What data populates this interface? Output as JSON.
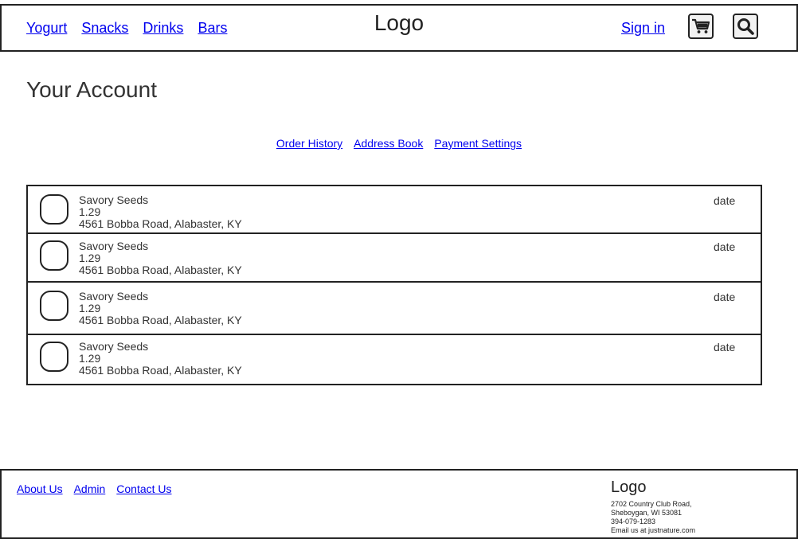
{
  "header": {
    "nav": [
      "Yogurt",
      "Snacks",
      "Drinks",
      "Bars"
    ],
    "logo": "Logo",
    "sign_in": "Sign in",
    "cart_icon": "cart-icon",
    "search_icon": "search-icon"
  },
  "page": {
    "title": "Your Account"
  },
  "subnav": [
    "Order History",
    "Address Book",
    "Payment Settings"
  ],
  "orders": [
    {
      "name": "Savory Seeds",
      "price": "1.29",
      "address": "4561 Bobba Road, Alabaster, KY",
      "date": "date"
    },
    {
      "name": "Savory Seeds",
      "price": "1.29",
      "address": "4561 Bobba Road, Alabaster, KY",
      "date": "date"
    },
    {
      "name": "Savory Seeds",
      "price": "1.29",
      "address": "4561 Bobba Road, Alabaster, KY",
      "date": "date"
    },
    {
      "name": "Savory Seeds",
      "price": "1.29",
      "address": "4561 Bobba Road, Alabaster, KY",
      "date": "date"
    }
  ],
  "footer": {
    "links": [
      "About Us",
      "Admin",
      "Contact Us"
    ],
    "logo": "Logo",
    "address_line1": "2702 Country Club Road,",
    "address_line2": "Sheboygan, WI 53081",
    "phone": "394-079-1283",
    "email": "Email us at justnature.com"
  }
}
